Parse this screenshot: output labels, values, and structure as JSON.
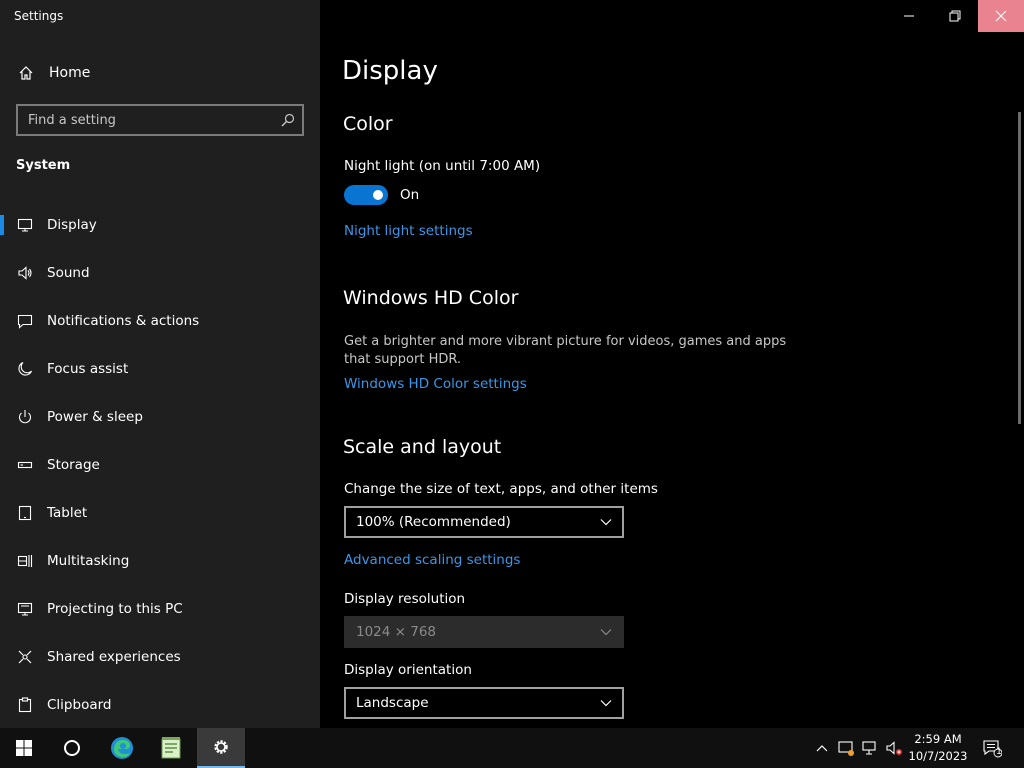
{
  "window": {
    "title": "Settings"
  },
  "sidebar": {
    "home_label": "Home",
    "search_placeholder": "Find a setting",
    "section": "System",
    "items": [
      {
        "label": "Display",
        "icon": "monitor-icon",
        "active": true
      },
      {
        "label": "Sound",
        "icon": "speaker-icon"
      },
      {
        "label": "Notifications & actions",
        "icon": "notification-icon"
      },
      {
        "label": "Focus assist",
        "icon": "moon-icon"
      },
      {
        "label": "Power & sleep",
        "icon": "power-icon"
      },
      {
        "label": "Storage",
        "icon": "storage-icon"
      },
      {
        "label": "Tablet",
        "icon": "tablet-icon"
      },
      {
        "label": "Multitasking",
        "icon": "multitasking-icon"
      },
      {
        "label": "Projecting to this PC",
        "icon": "projecting-icon"
      },
      {
        "label": "Shared experiences",
        "icon": "shared-icon"
      },
      {
        "label": "Clipboard",
        "icon": "clipboard-icon"
      }
    ]
  },
  "main": {
    "title": "Display",
    "color": {
      "heading": "Color",
      "night_light_label": "Night light (on until 7:00 AM)",
      "toggle_state": "On",
      "night_light_link": "Night light settings"
    },
    "hd_color": {
      "heading": "Windows HD Color",
      "description": "Get a brighter and more vibrant picture for videos, games and apps that support HDR.",
      "link": "Windows HD Color settings"
    },
    "scale": {
      "heading": "Scale and layout",
      "size_label": "Change the size of text, apps, and other items",
      "size_value": "100% (Recommended)",
      "advanced_link": "Advanced scaling settings",
      "resolution_label": "Display resolution",
      "resolution_value": "1024 × 768",
      "orientation_label": "Display orientation",
      "orientation_value": "Landscape"
    }
  },
  "taskbar": {
    "time": "2:59 AM",
    "date": "10/7/2023",
    "notification_count": "1"
  },
  "colors": {
    "accent": "#0a74d3",
    "link": "#3a96e8",
    "close_hover": "#e8838f"
  }
}
